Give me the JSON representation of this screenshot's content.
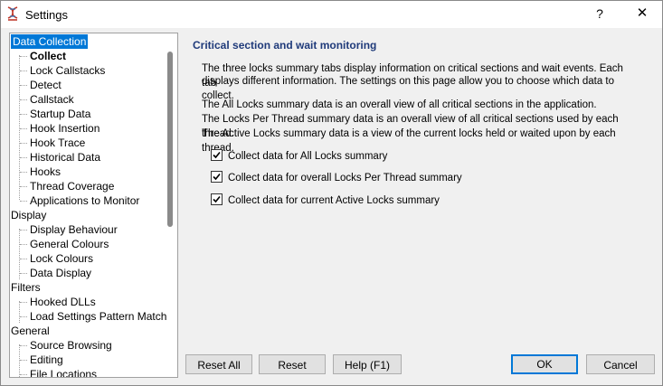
{
  "window": {
    "title": "Settings",
    "help_glyph": "?",
    "close_glyph": "✕"
  },
  "tree": {
    "items": [
      {
        "label": "Data Collection",
        "level": 0,
        "selected": true
      },
      {
        "label": "Collect",
        "level": 1,
        "bold": true
      },
      {
        "label": "Lock Callstacks",
        "level": 1
      },
      {
        "label": "Detect",
        "level": 1
      },
      {
        "label": "Callstack",
        "level": 1
      },
      {
        "label": "Startup Data",
        "level": 1
      },
      {
        "label": "Hook Insertion",
        "level": 1
      },
      {
        "label": "Hook Trace",
        "level": 1
      },
      {
        "label": "Historical Data",
        "level": 1
      },
      {
        "label": "Hooks",
        "level": 1
      },
      {
        "label": "Thread Coverage",
        "level": 1
      },
      {
        "label": "Applications to Monitor",
        "level": 1
      },
      {
        "label": "Display",
        "level": 0
      },
      {
        "label": "Display Behaviour",
        "level": 1
      },
      {
        "label": "General Colours",
        "level": 1
      },
      {
        "label": "Lock Colours",
        "level": 1
      },
      {
        "label": "Data Display",
        "level": 1
      },
      {
        "label": "Filters",
        "level": 0
      },
      {
        "label": "Hooked DLLs",
        "level": 1
      },
      {
        "label": "Load Settings Pattern Match",
        "level": 1
      },
      {
        "label": "General",
        "level": 0
      },
      {
        "label": "Source Browsing",
        "level": 1
      },
      {
        "label": "Editing",
        "level": 1
      },
      {
        "label": "File Locations",
        "level": 1
      }
    ]
  },
  "content": {
    "heading": "Critical section and wait monitoring",
    "intro_line1": "The three locks summary tabs display information on critical sections and wait events. Each tab",
    "intro_line2": "displays different information. The settings on this page allow you to choose which data to collect.",
    "desc1": "The All Locks summary data is an overall view of all critical sections in the application.",
    "desc2": "The Locks Per Thread summary data is an overall view of all critical sections used by each thread.",
    "desc3": "The Active Locks summary data is a view of the current locks held or waited upon by each thread.",
    "checkboxes": [
      {
        "label": "Collect data for All Locks summary",
        "checked": true
      },
      {
        "label": "Collect data for overall Locks Per Thread summary",
        "checked": true
      },
      {
        "label": "Collect data for current Active Locks summary",
        "checked": true
      }
    ]
  },
  "buttons": {
    "reset_all": "Reset All",
    "reset": "Reset",
    "help": "Help (F1)",
    "ok": "OK",
    "cancel": "Cancel"
  }
}
